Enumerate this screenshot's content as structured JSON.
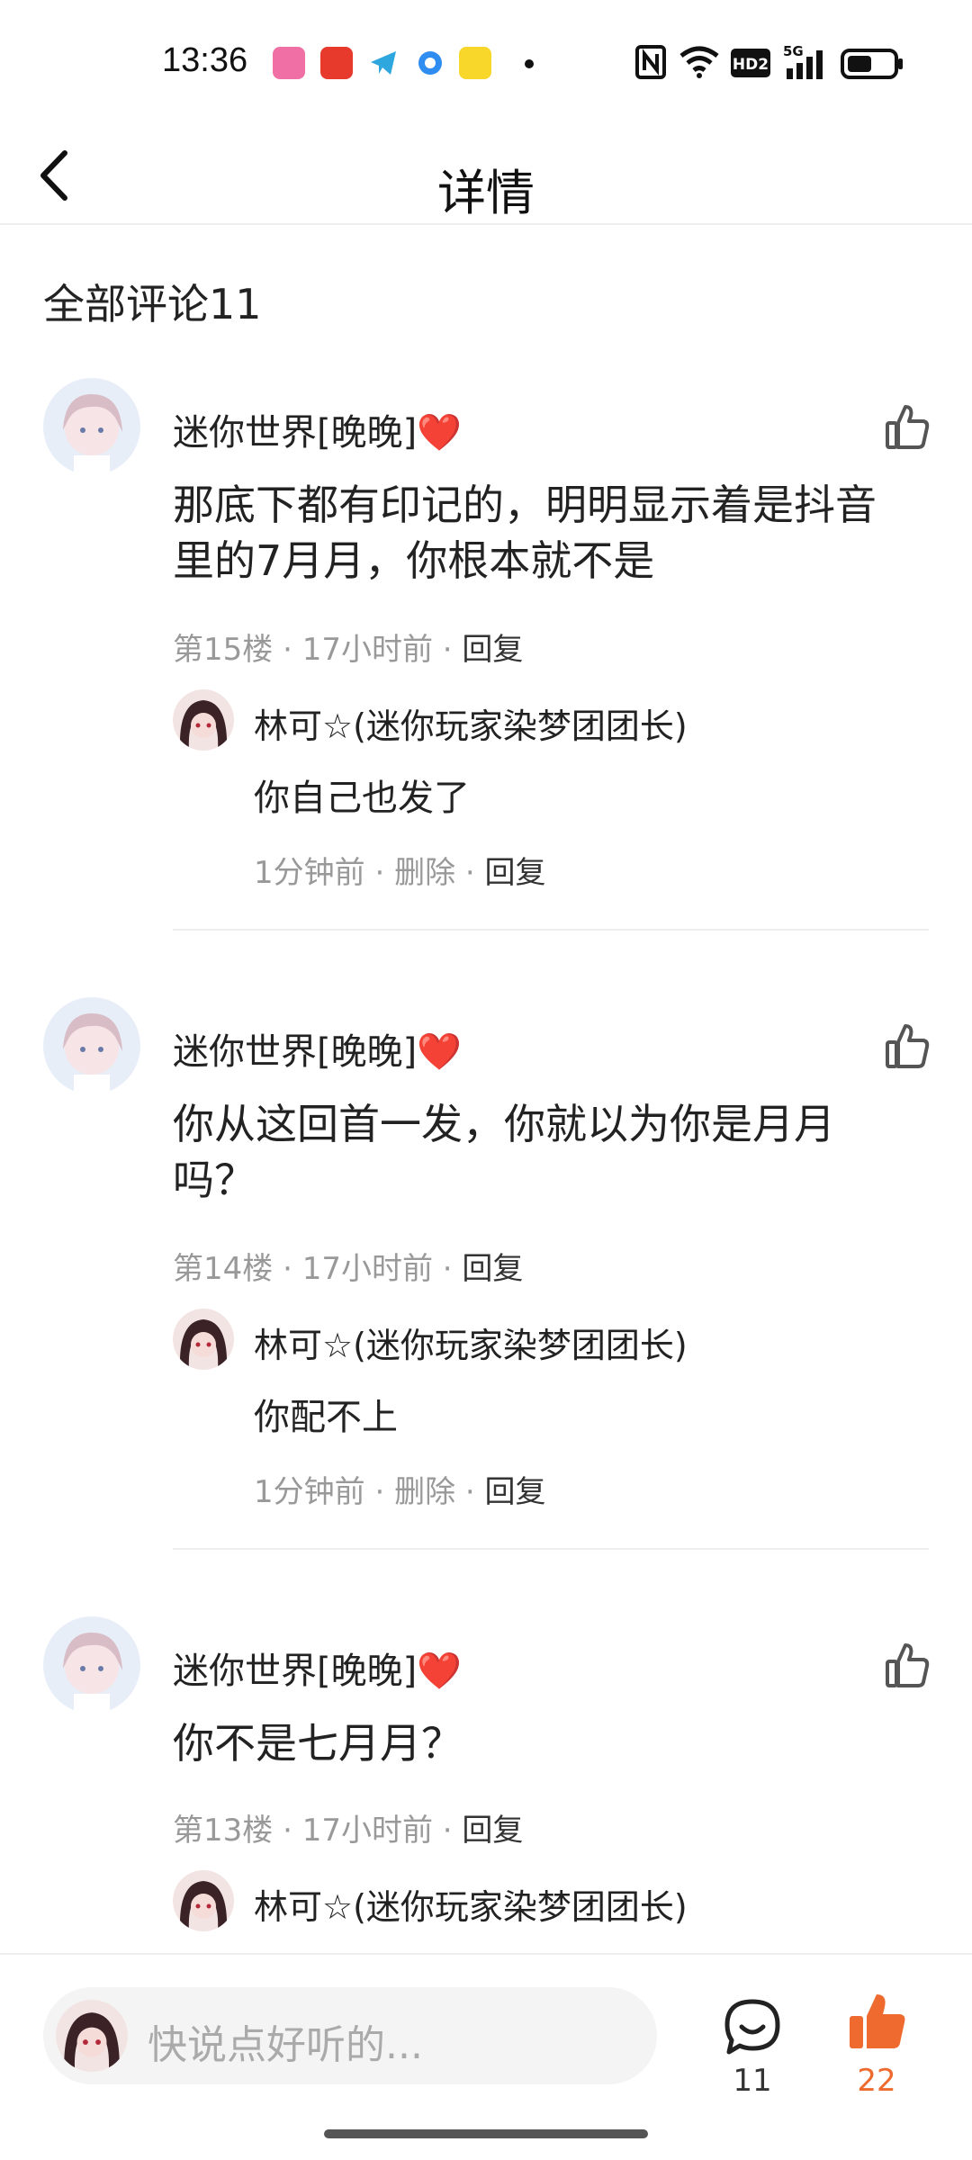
{
  "status_bar": {
    "time": "13:36",
    "icons": [
      "bilibili-app-icon",
      "red-envelope-app-icon",
      "telegram-app-icon",
      "browser-app-icon",
      "kuaikan-app-icon",
      "nfc-icon",
      "wifi-icon",
      "hd2-icon",
      "5g-signal-icon",
      "battery-icon"
    ],
    "hd_label": "HD2",
    "net_label": "5G"
  },
  "header": {
    "title": "详情"
  },
  "section": {
    "title": "全部评论11"
  },
  "comments": [
    {
      "author": "迷你世界[晚晚]❤️",
      "text": "那底下都有印记的，明明显示着是抖音里的7月月，你根本就不是",
      "floor": "第15楼",
      "time": "17小时前",
      "reply": "回复",
      "sub_reply": {
        "author": "林可☆(迷你玩家染梦团团长)",
        "text": "你自己也发了",
        "time": "1分钟前",
        "delete": "删除",
        "reply": "回复"
      }
    },
    {
      "author": "迷你世界[晚晚]❤️",
      "text": "你从这回首一发，你就以为你是月月吗？",
      "floor": "第14楼",
      "time": "17小时前",
      "reply": "回复",
      "sub_reply": {
        "author": "林可☆(迷你玩家染梦团团长)",
        "text": "你配不上",
        "time": "1分钟前",
        "delete": "删除",
        "reply": "回复"
      }
    },
    {
      "author": "迷你世界[晚晚]❤️",
      "text": "你不是七月月？",
      "floor": "第13楼",
      "time": "17小时前",
      "reply": "回复",
      "sub_reply": {
        "author": "林可☆(迷你玩家染梦团团长)"
      }
    }
  ],
  "bottom_bar": {
    "placeholder": "快说点好听的...",
    "comment_count": "11",
    "like_count": "22"
  },
  "colors": {
    "accent": "#ee6a2e",
    "muted": "#999999",
    "divider": "#eeeeee"
  }
}
